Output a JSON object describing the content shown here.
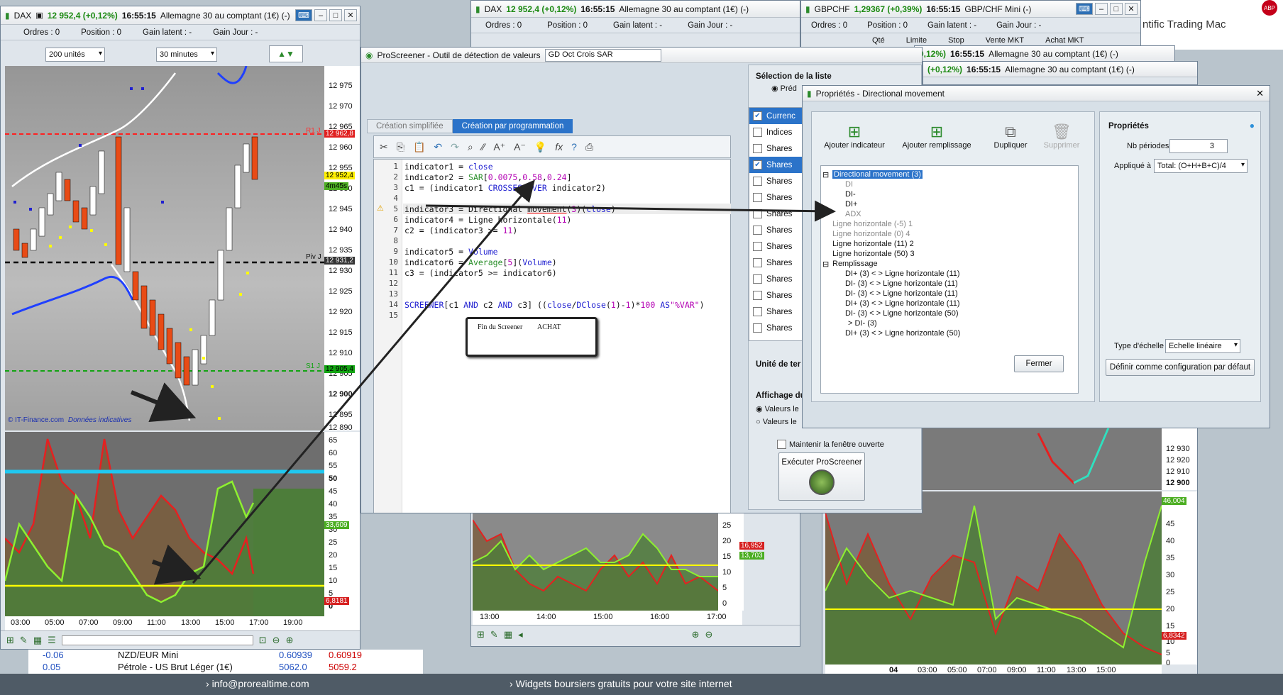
{
  "dax_window": {
    "instrument": "DAX",
    "price": "12 952,4 (+0,12%)",
    "time": "16:55:15",
    "desc": "Allemagne 30 au comptant (1€) (-)",
    "orders": "Ordres : 0",
    "orders_count": "0",
    "position": "Position : 0",
    "position_count": "0",
    "gain_latent": "Gain latent : -",
    "gain_jour": "Gain Jour : -",
    "units_select": "200 unités",
    "period_select": "30 minutes",
    "price_axis": [
      "12 975",
      "12 970",
      "12 965",
      "12 960",
      "12 955",
      "12 950",
      "12 945",
      "12 940",
      "12 935",
      "12 930",
      "12 925",
      "12 920",
      "12 915",
      "12 910",
      "12 905",
      "12 900",
      "12 895",
      "12 890"
    ],
    "labels": {
      "r1": "R1 J",
      "r1_val": "12 962,8",
      "cur": "12 952,4",
      "timer": "4m45s",
      "piv": "Piv J",
      "piv_val": "12 931,2",
      "s1": "S1 J",
      "s1_val": "12 905,4"
    },
    "copyright": "© IT-Finance.com",
    "data_note": "Données indicatives",
    "ind_axis": [
      "65",
      "60",
      "55",
      "50",
      "45",
      "40",
      "35",
      "30",
      "25",
      "20",
      "15",
      "10",
      "5",
      "0"
    ],
    "ind_labels": {
      "green": "33,609",
      "red": "6,8181"
    },
    "time_axis": [
      "03:00",
      "05:00",
      "07:00",
      "09:00",
      "11:00",
      "13:00",
      "15:00",
      "17:00",
      "19:00"
    ]
  },
  "mid_window": {
    "instrument": "DAX",
    "price": "12 952,4 (+0,12%)",
    "time": "16:55:15",
    "desc": "Allemagne 30 au comptant (1€) (-)",
    "orders": "Ordres : 0",
    "position": "Position : 0",
    "gain_latent": "Gain latent : -",
    "gain_jour": "Gain Jour : -",
    "axis": [
      "25",
      "20",
      "15",
      "10",
      "5",
      "0"
    ],
    "labels": {
      "red": "16,952",
      "green": "13,703"
    },
    "time_axis": [
      "13:00",
      "14:00",
      "15:00",
      "16:00",
      "17:00"
    ]
  },
  "gbp_window": {
    "instrument": "GBPCHF",
    "price": "1,29367 (+0,39%)",
    "time": "16:55:15",
    "desc": "GBP/CHF Mini (-)",
    "orders": "Ordres : 0",
    "position": "Position : 0",
    "gain_latent": "Gain latent : -",
    "gain_jour": "Gain Jour : -",
    "cols": [
      "Qté",
      "Limite",
      "Stop",
      "Vente MKT",
      "Achat MKT"
    ]
  },
  "small_windows": [
    {
      "price": "0,12%)",
      "time": "16:55:15",
      "desc": "Allemagne 30 au comptant (1€) (-)"
    },
    {
      "price": "(+0,12%)",
      "time": "16:55:15",
      "desc": "Allemagne 30 au comptant (1€) (-)"
    }
  ],
  "right_window": {
    "axis_top": [
      "12 930",
      "12 920",
      "12 910",
      "12 900"
    ],
    "axis": [
      "45",
      "40",
      "35",
      "30",
      "25",
      "20",
      "15",
      "10",
      "5",
      "0"
    ],
    "labels": {
      "green": "46,004",
      "red": "6,8342"
    },
    "time_axis": [
      "04",
      "03:00",
      "05:00",
      "07:00",
      "09:00",
      "11:00",
      "13:00",
      "15:00"
    ]
  },
  "browser": {
    "text": "ntific Trading Mac",
    "abp": "ABP"
  },
  "proscreener": {
    "title": "ProScreener - Outil de détection de valeurs",
    "name": "GD Oct Crois SAR",
    "tabs": [
      "Création simplifiée",
      "Création par programmation"
    ],
    "line_numbers": [
      "1",
      "2",
      "3",
      "4",
      "5",
      "6",
      "7",
      "8",
      "9",
      "10",
      "11",
      "12",
      "13",
      "14",
      "15"
    ],
    "end_label": "Fin du Screener",
    "achat": "ACHAT",
    "selection_title": "Sélection de la liste",
    "predef": "Préd",
    "list_items": [
      "Currenc",
      "Indices",
      "Shares",
      "Shares",
      "Shares",
      "Shares",
      "Shares",
      "Shares",
      "Shares",
      "Shares",
      "Shares",
      "Shares",
      "Shares",
      "Shares"
    ],
    "unit_label": "Unité de ter",
    "affichage": "Affichage du",
    "valeurs1": "Valeurs le",
    "valeurs2": "Valeurs le",
    "keep_open": "Maintenir la fenêtre ouverte",
    "run": "Exécuter ProScreener"
  },
  "props": {
    "title": "Propriétés - Directional movement",
    "actions": [
      "Ajouter indicateur",
      "Ajouter remplissage",
      "Dupliquer",
      "Supprimer"
    ],
    "tree": [
      "Directional movement (3)",
      "DI",
      "DI-",
      "DI+",
      "ADX",
      "Ligne horizontale (-5) 1",
      "Ligne horizontale (0) 4",
      "Ligne horizontale (11) 2",
      "Ligne horizontale (50) 3",
      "Remplissage",
      "DI+ (3) < > Ligne horizontale (11)",
      "DI- (3) < > Ligne horizontale (11)",
      "DI- (3) < > Ligne horizontale (11)",
      "DI+ (3) < > Ligne horizontale (11)",
      "DI- (3) < > Ligne horizontale (50)",
      "> DI- (3)",
      "DI+ (3) < > Ligne horizontale (50)"
    ],
    "heading": "Propriétés",
    "nb_periodes": "Nb périodes",
    "nb_value": "3",
    "applique": "Appliqué à",
    "applique_value": "Total: (O+H+B+C)/4",
    "type_echelle": "Type d'échelle",
    "echelle_value": "Echelle linéaire",
    "default_btn": "Définir comme configuration par défaut",
    "close_btn": "Fermer"
  },
  "list_rows": [
    {
      "change": "-0.06",
      "name": "NZD/EUR Mini",
      "bid": "0.60939",
      "ask": "0.60919"
    },
    {
      "change": "0.05",
      "name": "Pétrole - US Brut Léger (1€)",
      "bid": "5062.0",
      "ask": "5059.2"
    }
  ],
  "footer": {
    "email": "info@prorealtime.com",
    "widgets": "Widgets boursiers gratuits pour votre site internet"
  }
}
